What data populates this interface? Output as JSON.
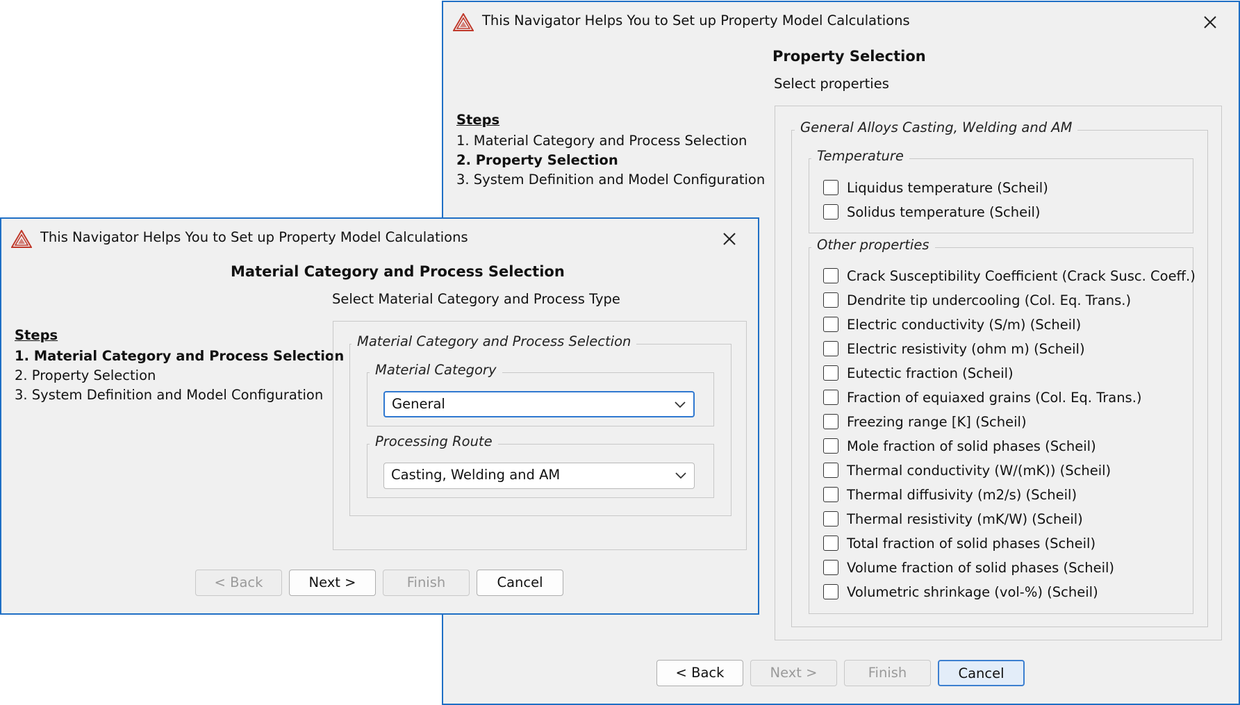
{
  "colors": {
    "dialog_border": "#1f6fc5",
    "dialog_bg": "#f0f0f0",
    "logo": "#c0392b",
    "focus": "#2f78d0"
  },
  "back_dialog": {
    "title": "This Navigator Helps You to Set up Property Model Calculations",
    "heading": "Property Selection",
    "subheading": "Select properties",
    "steps": {
      "title": "Steps",
      "items": [
        "1. Material Category and Process Selection",
        "2. Property Selection",
        "3. System Definition and Model Configuration"
      ]
    },
    "outer_group": "General Alloys Casting, Welding and AM",
    "temperature_group": {
      "label": "Temperature",
      "items": [
        "Liquidus temperature (Scheil)",
        "Solidus temperature (Scheil)"
      ]
    },
    "other_group": {
      "label": "Other properties",
      "items": [
        "Crack Susceptibility Coefficient (Crack Susc. Coeff.)",
        "Dendrite tip undercooling (Col. Eq. Trans.)",
        "Electric conductivity (S/m) (Scheil)",
        "Electric resistivity (ohm m) (Scheil)",
        "Eutectic fraction (Scheil)",
        "Fraction of equiaxed grains (Col. Eq. Trans.)",
        "Freezing range [K] (Scheil)",
        "Mole fraction of solid phases (Scheil)",
        "Thermal conductivity (W/(mK)) (Scheil)",
        "Thermal diffusivity (m2/s) (Scheil)",
        "Thermal resistivity (mK/W) (Scheil)",
        "Total fraction of solid phases (Scheil)",
        "Volume fraction of solid phases (Scheil)",
        "Volumetric shrinkage (vol-%) (Scheil)"
      ]
    },
    "buttons": {
      "back": "< Back",
      "next": "Next >",
      "finish": "Finish",
      "cancel": "Cancel"
    }
  },
  "front_dialog": {
    "title": "This Navigator Helps You to Set up Property Model Calculations",
    "heading": "Material Category and Process Selection",
    "subheading": "Select Material Category and Process Type",
    "steps": {
      "title": "Steps",
      "items": [
        "1. Material Category and Process Selection",
        "2. Property Selection",
        "3. System Definition and Model Configuration"
      ]
    },
    "outer_group": "Material Category and Process Selection",
    "material_category": {
      "label": "Material Category",
      "value": "General"
    },
    "processing_route": {
      "label": "Processing Route",
      "value": "Casting, Welding and AM"
    },
    "buttons": {
      "back": "< Back",
      "next": "Next >",
      "finish": "Finish",
      "cancel": "Cancel"
    }
  }
}
